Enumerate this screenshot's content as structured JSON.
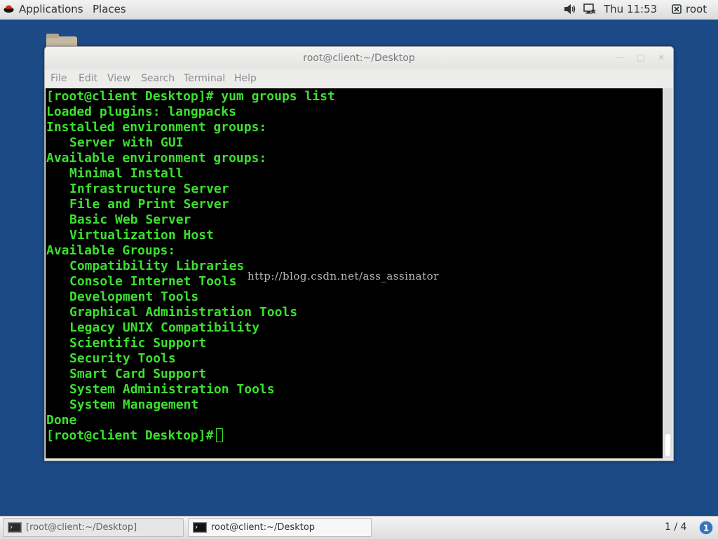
{
  "topbar": {
    "applications": "Applications",
    "places": "Places",
    "clock": "Thu 11:53",
    "user": "root",
    "icons": [
      "redhat-logo-icon",
      "volume-icon",
      "network-icon",
      "user-icon"
    ]
  },
  "window": {
    "title": "root@client:~/Desktop",
    "controls": [
      "minimize",
      "maximize",
      "close"
    ],
    "menu": [
      "File",
      "Edit",
      "View",
      "Search",
      "Terminal",
      "Help"
    ]
  },
  "terminal": {
    "lines": [
      {
        "text": "[root@client Desktop]# yum groups list",
        "indent": false
      },
      {
        "text": "Loaded plugins: langpacks",
        "indent": false
      },
      {
        "text": "Installed environment groups:",
        "indent": false
      },
      {
        "text": "Server with GUI",
        "indent": true
      },
      {
        "text": "Available environment groups:",
        "indent": false
      },
      {
        "text": "Minimal Install",
        "indent": true
      },
      {
        "text": "Infrastructure Server",
        "indent": true
      },
      {
        "text": "File and Print Server",
        "indent": true
      },
      {
        "text": "Basic Web Server",
        "indent": true
      },
      {
        "text": "Virtualization Host",
        "indent": true
      },
      {
        "text": "Available Groups:",
        "indent": false
      },
      {
        "text": "Compatibility Libraries",
        "indent": true
      },
      {
        "text": "Console Internet Tools",
        "indent": true
      },
      {
        "text": "Development Tools",
        "indent": true
      },
      {
        "text": "Graphical Administration Tools",
        "indent": true
      },
      {
        "text": "Legacy UNIX Compatibility",
        "indent": true
      },
      {
        "text": "Scientific Support",
        "indent": true
      },
      {
        "text": "Security Tools",
        "indent": true
      },
      {
        "text": "Smart Card Support",
        "indent": true
      },
      {
        "text": "System Administration Tools",
        "indent": true
      },
      {
        "text": "System Management",
        "indent": true
      },
      {
        "text": "Done",
        "indent": false
      }
    ],
    "prompt": "[root@client Desktop]#",
    "text_color": "#3be02e",
    "background": "#000000"
  },
  "watermark": "http://blog.csdn.net/ass_assinator",
  "taskbar": {
    "tasks": [
      {
        "label": "[root@client:~/Desktop]",
        "active": false
      },
      {
        "label": "root@client:~/Desktop",
        "active": true
      }
    ],
    "workspace": "1 / 4"
  },
  "colors": {
    "desktop": "#1c4a86",
    "terminal_green": "#3be02e"
  }
}
